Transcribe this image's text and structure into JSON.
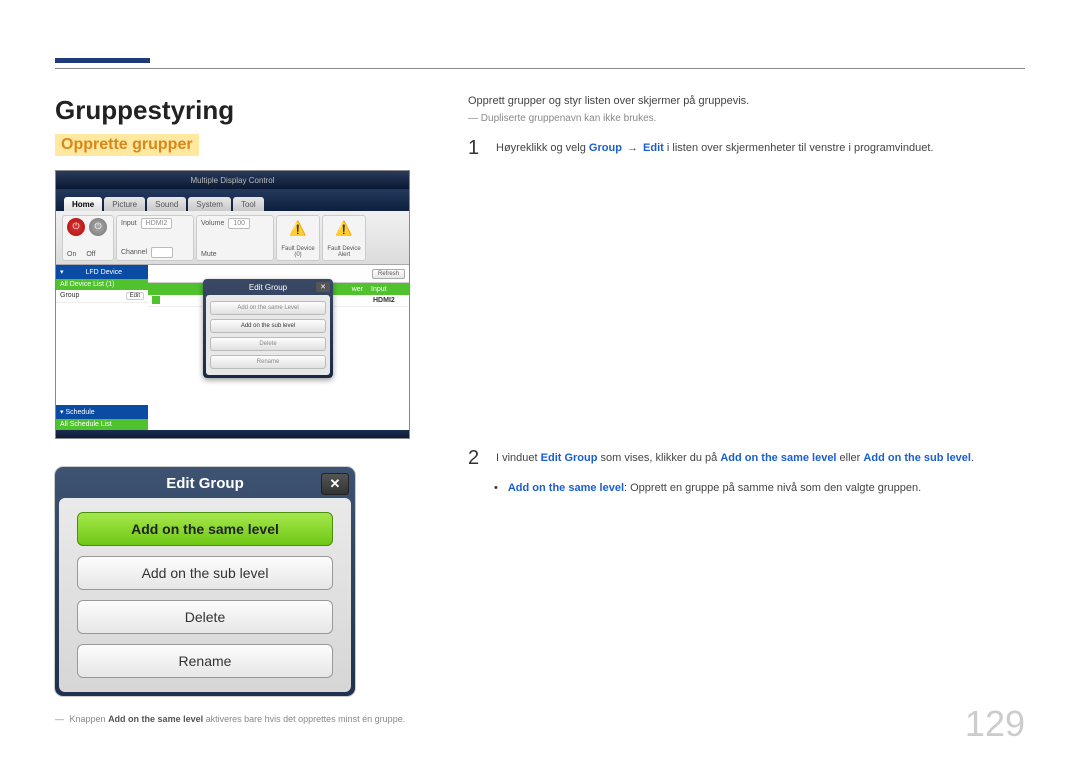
{
  "page_number": "129",
  "left": {
    "heading1": "Gruppestyring",
    "heading2": "Opprette grupper",
    "mdc": {
      "title": "Multiple Display Control",
      "tabs": [
        "Home",
        "Picture",
        "Sound",
        "System",
        "Tool"
      ],
      "power": {
        "on": "On",
        "off": "Off"
      },
      "input": {
        "label": "Input",
        "value": "HDMI2",
        "channel": "Channel"
      },
      "volume": {
        "label": "Volume",
        "value": "100",
        "mute": "Mute"
      },
      "fault_id": "Fault Device (0)",
      "fault_alert": "Fault Device Alert",
      "side": {
        "lfd": "LFD Device",
        "all_list": "All Device List (1)",
        "group": "Group",
        "edit": "Edit",
        "schedule": "Schedule",
        "all_schedule": "All Schedule List"
      },
      "refresh": "Refresh",
      "table_headers": {
        "power": "wer",
        "input": "Input"
      },
      "row_input": "HDMI2",
      "dialog": {
        "title": "Edit Group",
        "opt1": "Add on the same Level",
        "opt2": "Add on the sub level",
        "opt3": "Delete",
        "opt4": "Rename"
      }
    },
    "edit_group": {
      "title": "Edit Group",
      "btn1": "Add on the same level",
      "btn2": "Add on the sub level",
      "btn3": "Delete",
      "btn4": "Rename"
    },
    "footnote_prefix": "―",
    "footnote_text1": "Knappen ",
    "footnote_bold": "Add on the same level",
    "footnote_text2": " aktiveres bare hvis det opprettes minst én gruppe."
  },
  "right": {
    "intro": "Opprett grupper og styr listen over skjermer på gruppevis.",
    "note_prefix": "―",
    "note": "Dupliserte gruppenavn kan ikke brukes.",
    "step1_num": "1",
    "step1_a": "Høyreklikk og velg ",
    "step1_group": "Group",
    "step1_arrow": "→",
    "step1_edit": "Edit",
    "step1_b": " i listen over skjermenheter til venstre i programvinduet.",
    "step2_num": "2",
    "step2_a": "I vinduet ",
    "step2_kw1": "Edit Group",
    "step2_b": " som vises, klikker du på ",
    "step2_kw2": "Add on the same level",
    "step2_c": " eller ",
    "step2_kw3": "Add on the sub level",
    "step2_d": ".",
    "bullet_kw": "Add on the same level",
    "bullet_text": ": Opprett en gruppe på samme nivå som den valgte gruppen."
  }
}
